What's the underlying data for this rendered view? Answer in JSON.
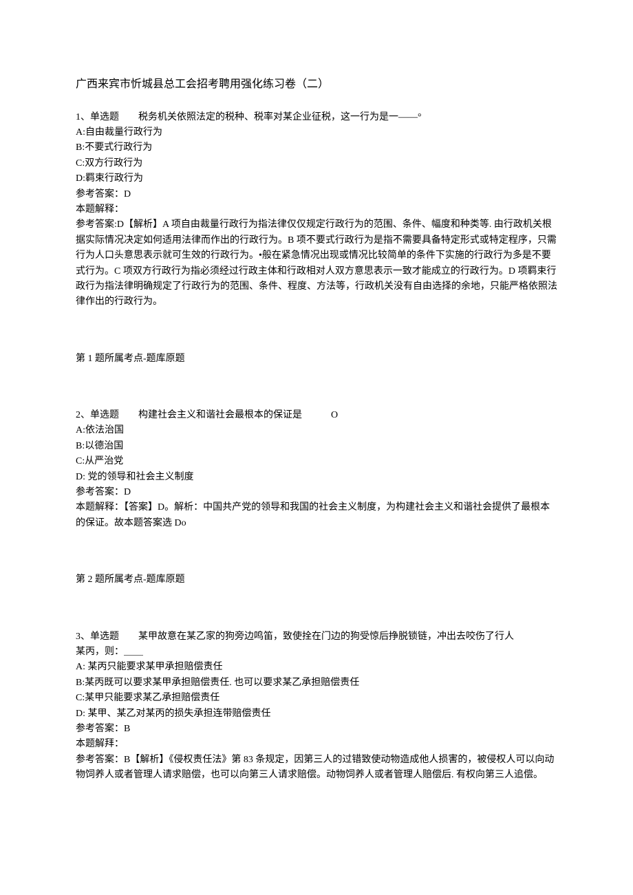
{
  "title": "广西来宾市忻城县总工会招考聘用强化练习卷（二）",
  "q1": {
    "stem": "1、单选题　　税务机关依照法定的税种、税率对某企业征税，这一行为是一——°",
    "a": "A:自由裁量行政行为",
    "b": "B:不要式行政行为",
    "c": "C:双方行政行为",
    "d": "D:羁束行政行为",
    "ref": "参考答案：D",
    "explLabel": "本题解释：",
    "expl": "参考答案:D【解析】A 项自由裁量行政行为指法律仅仅规定行政行为的范围、条件、幅度和种类等. 由行政机关根据实际情况决定如何适用法律而作出的行政行为。B 项不要式行政行为是指不需要具备特定形式或特定程序，只需行为人口头意思表示就可生效的行政行为。•般在紧急情况出现或情况比较简单的条件下实施的行政行为多是不要式行为。C 项双方行政行为指必须经过行政主体和行政相对人双方意思表示一致才能成立的行政行为。D 项羁束行政行为指法律明确规定了行政行为的范围、条件、程度、方法等，行政机关没有自由选择的余地，只能严格依照法律作出的行政行为。",
    "origin": "第 1 题所属考点-题库原题"
  },
  "q2": {
    "stem": "2、单选题　　构建社会主义和谐社会最根本的保证是　　　O",
    "a": "A:依法治国",
    "b": "B:以德治国",
    "c": "C:从严治党",
    "d": "D: 党的领导和社会主义制度",
    "ref": "参考答案：D",
    "expl": "本题解释：【答案】D。解析：中国共产党的领导和我国的社会主义制度，为构建社会主义和谐社会提供了最根本的保证。故本题答案选 Do",
    "origin": "第 2 题所属考点-题库原题"
  },
  "q3": {
    "stem1": "3、单选题　　某甲故意在某乙家的狗旁边鸣笛，致使拴在门边的狗受惊后挣脱锁链，冲出去咬伤了行人",
    "stem2": "某丙，则：＿＿",
    "a": "A: 某丙只能要求某甲承担赔偿责任",
    "b": "B:某丙既可以要求某甲承担赔偿责任. 也可以要求某乙承担赔偿责任",
    "c": "C:某甲只能要求某乙承担赔偿责任",
    "d": "D: 某甲、某乙对某丙的损失承担连带赔偿责任",
    "ref": "参考答案：B",
    "explLabel": "本题解拜：",
    "expl": "参考答案：B【解析】《侵权责任法》第 83 条规定，因第三人的过错致使动物造成他人损害的，被侵权人可以向动物饲养人或者管理人请求赔偿，也可以向第三人请求赔偿。动物饲养人或者管理人赔偿后. 有权向第三人追偿。"
  }
}
